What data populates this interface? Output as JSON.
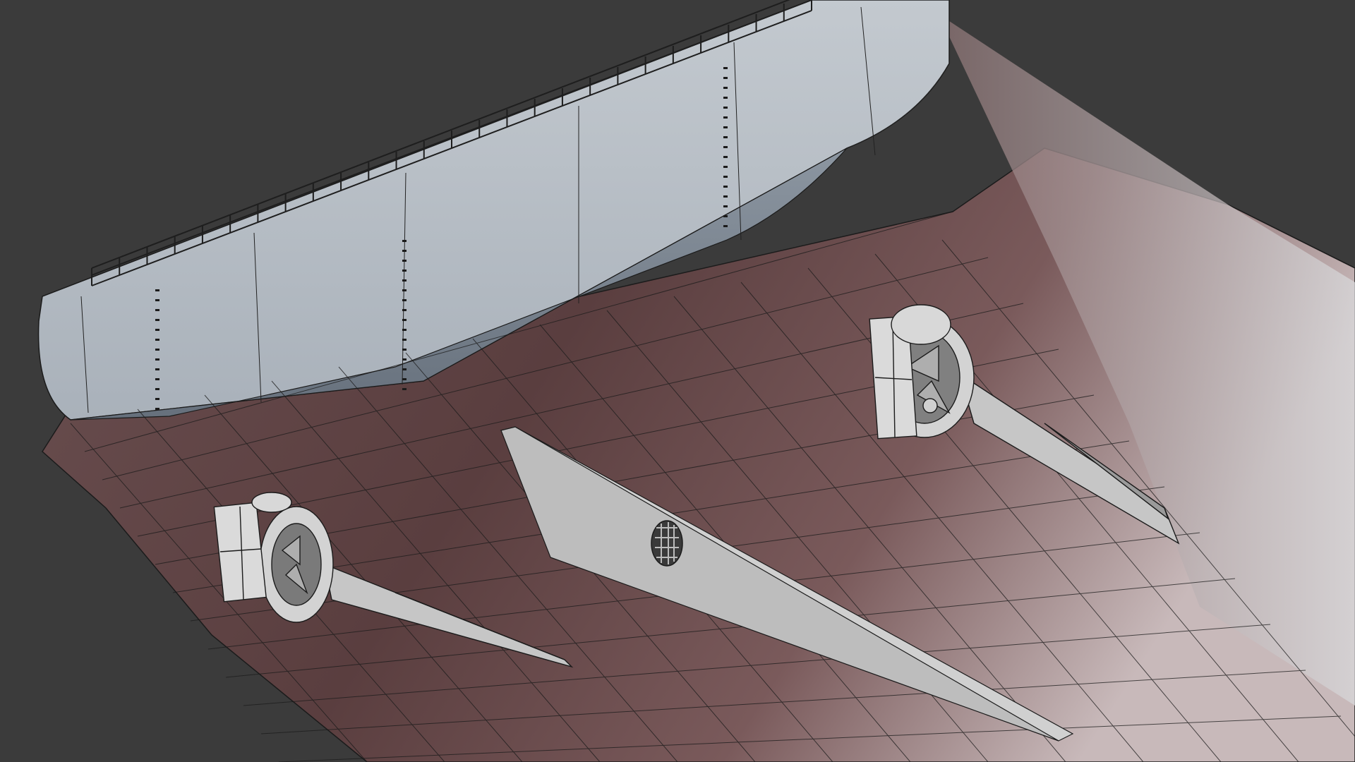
{
  "scene": {
    "subject": "ship-stern-hull-wireframe-render",
    "background_color": "#3b3b3b",
    "colors": {
      "hull_bottom": "#6a4a4b",
      "hull_bottom_dark": "#4e3536",
      "transom": "#b8bfc7",
      "transom_shade": "#6f7a86",
      "wire": "#1b1b1b",
      "appendage": "#cfcfcf",
      "railing": "#1e1e1e"
    }
  }
}
